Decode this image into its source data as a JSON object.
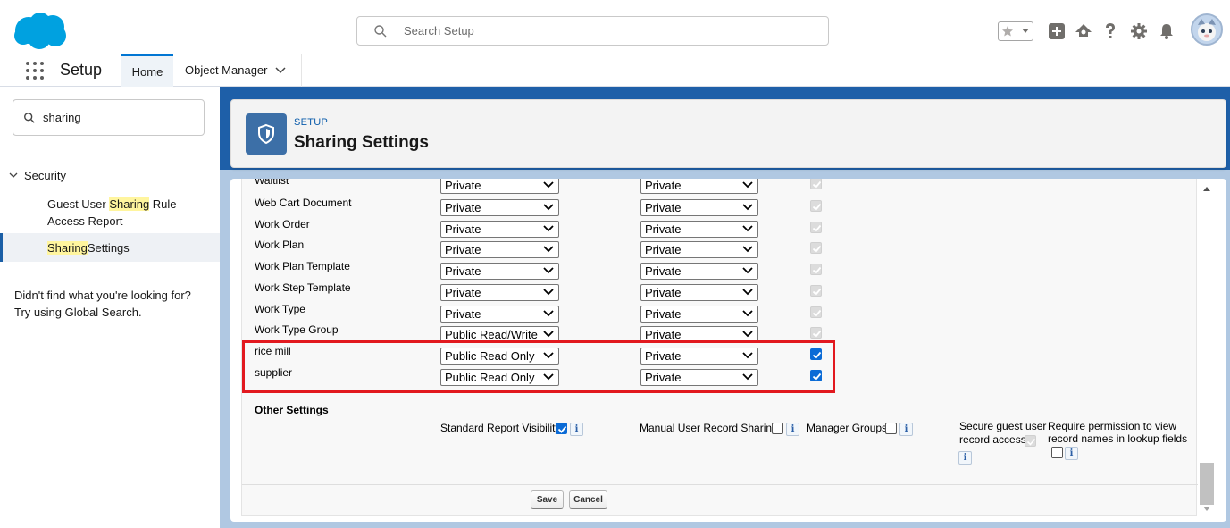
{
  "header": {
    "search_placeholder": "Search Setup"
  },
  "nav": {
    "app_name": "Setup",
    "tabs": [
      {
        "label": "Home",
        "active": true
      },
      {
        "label": "Object Manager"
      }
    ]
  },
  "sidebar": {
    "quickfind_value": "sharing",
    "section": "Security",
    "items": [
      {
        "pre": "Guest User ",
        "hl": "Sharing",
        "post": " Rule Access Report",
        "selected": false
      },
      {
        "pre": "",
        "hl": "Sharing",
        "post": " Settings",
        "selected": true
      }
    ],
    "not_found_line1": "Didn't find what you're looking for?",
    "not_found_line2": "Try using Global Search."
  },
  "page_header": {
    "eyebrow": "SETUP",
    "title": "Sharing Settings"
  },
  "sharing_rows": [
    {
      "label": "Waitlist",
      "internal": "Private",
      "external": "Private",
      "grant": "disabled"
    },
    {
      "label": "Web Cart Document",
      "internal": "Private",
      "external": "Private",
      "grant": "disabled"
    },
    {
      "label": "Work Order",
      "internal": "Private",
      "external": "Private",
      "grant": "disabled"
    },
    {
      "label": "Work Plan",
      "internal": "Private",
      "external": "Private",
      "grant": "disabled"
    },
    {
      "label": "Work Plan Template",
      "internal": "Private",
      "external": "Private",
      "grant": "disabled"
    },
    {
      "label": "Work Step Template",
      "internal": "Private",
      "external": "Private",
      "grant": "disabled"
    },
    {
      "label": "Work Type",
      "internal": "Private",
      "external": "Private",
      "grant": "disabled"
    },
    {
      "label": "Work Type Group",
      "internal": "Public Read/Write",
      "external": "Private",
      "grant": "disabled"
    },
    {
      "label": "rice mill",
      "internal": "Public Read Only",
      "external": "Private",
      "grant": "checked"
    },
    {
      "label": "supplier",
      "internal": "Public Read Only",
      "external": "Private",
      "grant": "checked"
    }
  ],
  "other_settings": {
    "title": "Other Settings",
    "standard_report_visibility": "Standard Report Visibility",
    "manual_user_record_sharing": "Manual User Record Sharing",
    "manager_groups": "Manager Groups",
    "secure_guest_line1": "Secure guest user",
    "secure_guest_line2": "record access",
    "require_perm_line1": "Require permission to view",
    "require_perm_line2": "record names in lookup fields",
    "info_glyph": "i"
  },
  "buttons": {
    "save": "Save",
    "cancel": "Cancel"
  },
  "colors": {
    "brand_blue": "#0176d3",
    "header_band": "#1e5fa8",
    "highlight_box": "#e2191f",
    "search_highlight": "#fff59e"
  }
}
